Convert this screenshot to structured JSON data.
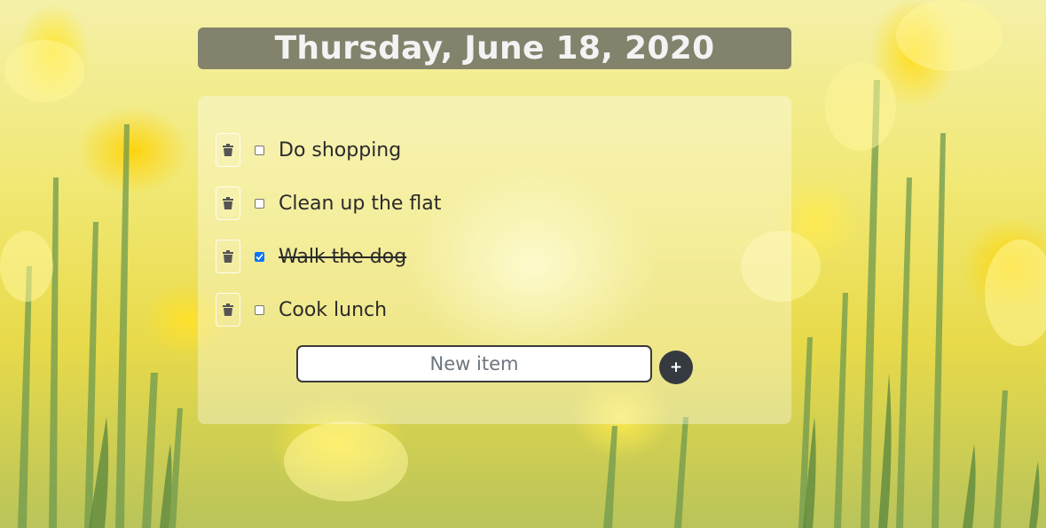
{
  "header": {
    "date_title": "Thursday, June 18, 2020"
  },
  "todos": [
    {
      "text": "Do shopping",
      "checked": false
    },
    {
      "text": "Clean up the flat",
      "checked": false
    },
    {
      "text": "Walk the dog",
      "checked": true
    },
    {
      "text": "Cook lunch",
      "checked": false
    }
  ],
  "new_item": {
    "placeholder": "New item",
    "value": ""
  },
  "add_button": {
    "label": "+"
  },
  "icons": {
    "delete": "trash-icon",
    "check": "checkmark-icon"
  },
  "colors": {
    "header_bg": "#6e6e64",
    "checkbox_checked": "#0b75f5",
    "add_button_bg": "#343a40"
  }
}
